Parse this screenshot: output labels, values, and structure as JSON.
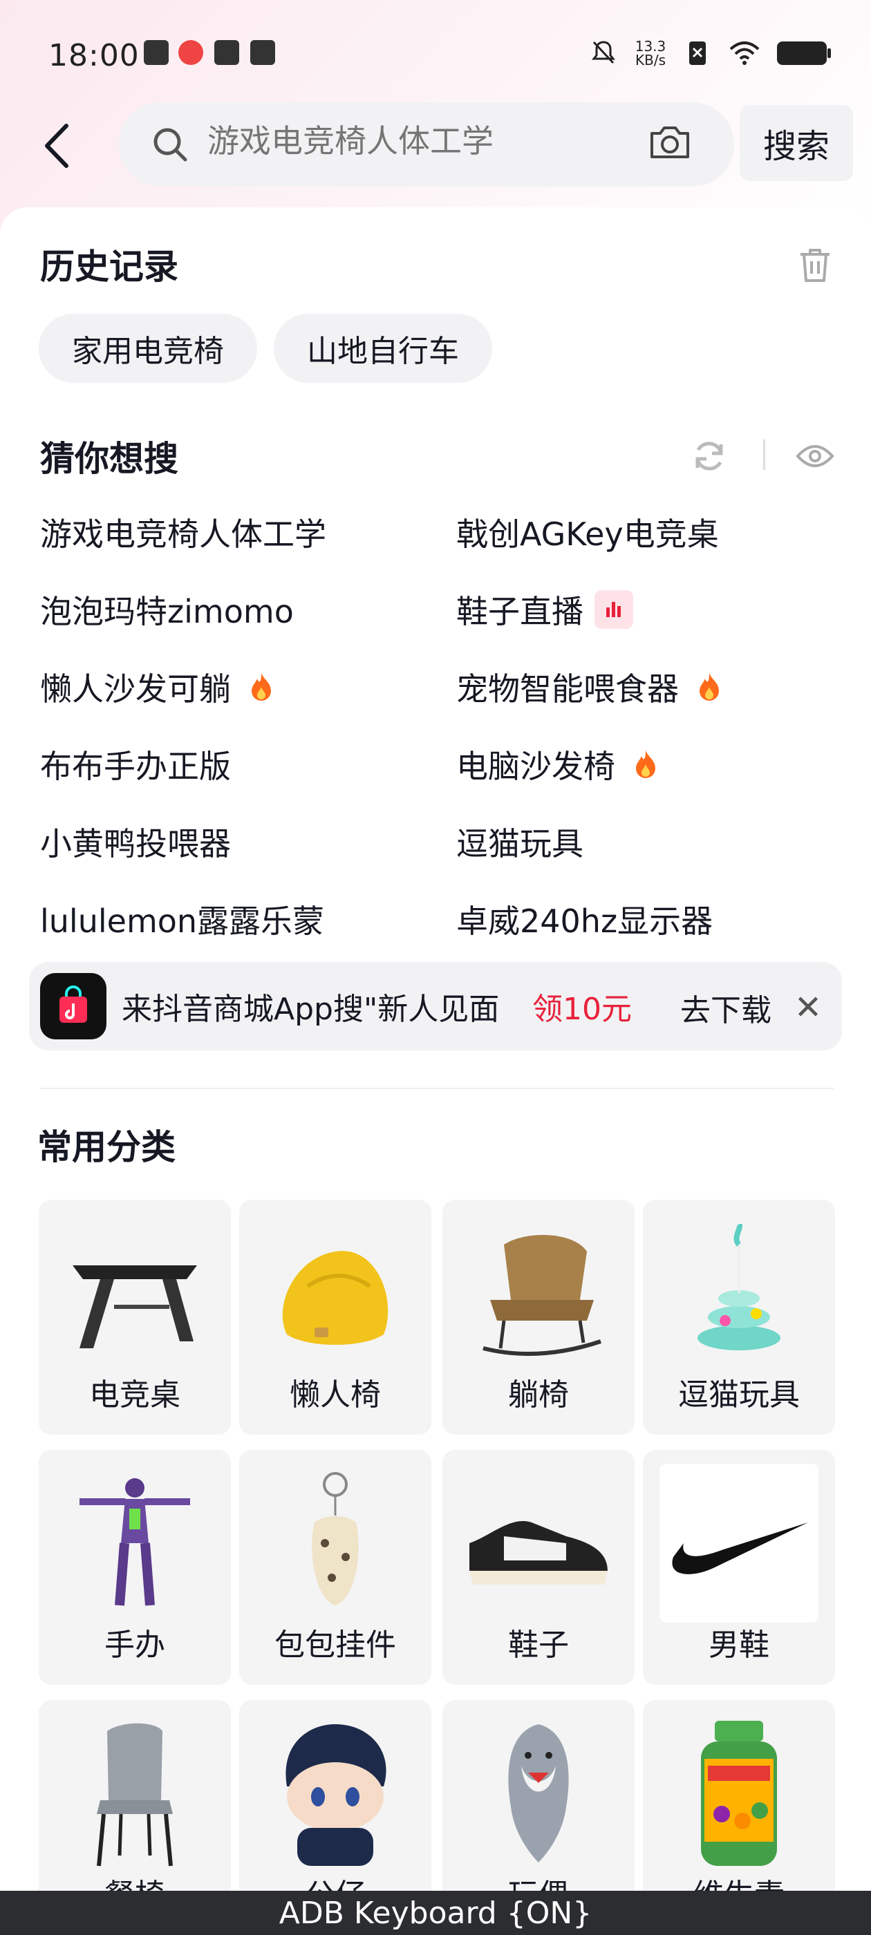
{
  "status_bar": {
    "time": "18:00",
    "netspeed_top": "13.3",
    "netspeed_bottom": "KB/s"
  },
  "header": {
    "search_placeholder": "游戏电竞椅人体工学",
    "search_button": "搜索"
  },
  "history": {
    "title": "历史记录",
    "items": [
      "家用电竞椅",
      "山地自行车"
    ]
  },
  "guess": {
    "title": "猜你想搜",
    "items": [
      {
        "label": "游戏电竞椅人体工学",
        "badge": ""
      },
      {
        "label": "戟创AGKey电竞桌",
        "badge": ""
      },
      {
        "label": "泡泡玛特zimomo",
        "badge": ""
      },
      {
        "label": "鞋子直播",
        "badge": "live"
      },
      {
        "label": "懒人沙发可躺",
        "badge": "hot"
      },
      {
        "label": "宠物智能喂食器",
        "badge": "hot"
      },
      {
        "label": "布布手办正版",
        "badge": ""
      },
      {
        "label": "电脑沙发椅",
        "badge": "hot"
      },
      {
        "label": "小黄鸭投喂器",
        "badge": ""
      },
      {
        "label": "逗猫玩具",
        "badge": ""
      },
      {
        "label": "lululemon露露乐蒙",
        "badge": ""
      },
      {
        "label": "卓威240hz显示器",
        "badge": ""
      }
    ]
  },
  "promo": {
    "text": "来抖音商城App搜\"新人见面",
    "amount": "领10元",
    "download": "去下载",
    "close": "✕"
  },
  "categories": {
    "title": "常用分类",
    "items": [
      {
        "label": "电竞桌"
      },
      {
        "label": "懒人椅"
      },
      {
        "label": "躺椅"
      },
      {
        "label": "逗猫玩具"
      },
      {
        "label": "手办"
      },
      {
        "label": "包包挂件"
      },
      {
        "label": "鞋子"
      },
      {
        "label": "男鞋"
      },
      {
        "label": "餐椅"
      },
      {
        "label": "公仔"
      },
      {
        "label": "玩偶"
      },
      {
        "label": "维生素"
      }
    ]
  },
  "keyboard": {
    "label": "ADB Keyboard {ON}"
  },
  "colors": {
    "accent_red": "#e8203a",
    "chip_bg": "#f2f2f4",
    "card_bg": "#f4f4f5"
  }
}
